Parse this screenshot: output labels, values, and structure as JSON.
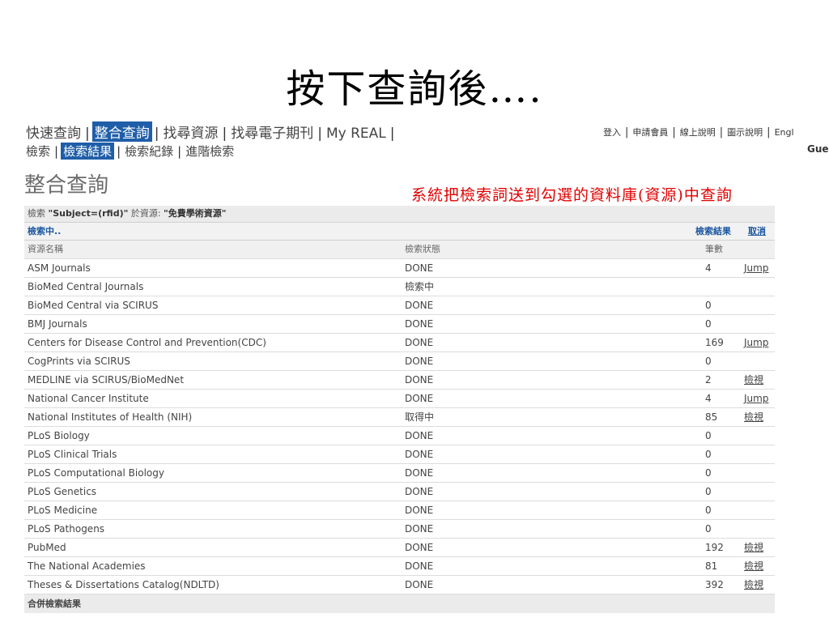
{
  "slide_title": "按下查詢後….",
  "nav_primary": [
    {
      "label": "快速查詢",
      "active": false
    },
    {
      "label": "整合查詢",
      "active": true
    },
    {
      "label": "找尋資源",
      "active": false
    },
    {
      "label": "找尋電子期刊",
      "active": false
    },
    {
      "label": "My REAL",
      "active": false
    }
  ],
  "nav_secondary": [
    {
      "label": "檢索",
      "active": false
    },
    {
      "label": "檢索結果",
      "active": true
    },
    {
      "label": "檢索紀錄",
      "active": false
    },
    {
      "label": "進階檢索",
      "active": false
    }
  ],
  "top_links": [
    "登入",
    "申請會員",
    "線上說明",
    "圖示說明",
    "Engl"
  ],
  "guest_label": "Gue",
  "page_title": "整合查詢",
  "annotation": "系統把檢索詞送到勾選的資料庫(資源)中查詢",
  "query_bar": {
    "prefix": "檢索 ",
    "query": "\"Subject=(rfid)\"",
    "middle": " 於資源: ",
    "resource": "\"免費學術資源\""
  },
  "status_bar": {
    "status": "檢索中..",
    "results_link": "檢索結果",
    "cancel_link": "取消"
  },
  "table": {
    "headers": {
      "name": "資源名稱",
      "status": "檢索狀態",
      "count": "筆數"
    },
    "rows": [
      {
        "name": "ASM Journals",
        "status": "DONE",
        "count": "4",
        "link": "Jump"
      },
      {
        "name": "BioMed Central Journals",
        "status": "檢索中",
        "count": "",
        "link": ""
      },
      {
        "name": "BioMed Central via SCIRUS",
        "status": "DONE",
        "count": "0",
        "link": ""
      },
      {
        "name": "BMJ Journals",
        "status": "DONE",
        "count": "0",
        "link": ""
      },
      {
        "name": "Centers for Disease Control and Prevention(CDC)",
        "status": "DONE",
        "count": "169",
        "link": "Jump"
      },
      {
        "name": "CogPrints via SCIRUS",
        "status": "DONE",
        "count": "0",
        "link": ""
      },
      {
        "name": "MEDLINE via SCIRUS/BioMedNet",
        "status": "DONE",
        "count": "2",
        "link": "檢視"
      },
      {
        "name": "National Cancer Institute",
        "status": "DONE",
        "count": "4",
        "link": "Jump"
      },
      {
        "name": "National Institutes of Health (NIH)",
        "status": "取得中",
        "count": "85",
        "link": "檢視"
      },
      {
        "name": "PLoS Biology",
        "status": "DONE",
        "count": "0",
        "link": ""
      },
      {
        "name": "PLoS Clinical Trials",
        "status": "DONE",
        "count": "0",
        "link": ""
      },
      {
        "name": "PLoS Computational Biology",
        "status": "DONE",
        "count": "0",
        "link": ""
      },
      {
        "name": "PLoS Genetics",
        "status": "DONE",
        "count": "0",
        "link": ""
      },
      {
        "name": "PLoS Medicine",
        "status": "DONE",
        "count": "0",
        "link": ""
      },
      {
        "name": "PLoS Pathogens",
        "status": "DONE",
        "count": "0",
        "link": ""
      },
      {
        "name": "PubMed",
        "status": "DONE",
        "count": "192",
        "link": "檢視"
      },
      {
        "name": "The National Academies",
        "status": "DONE",
        "count": "81",
        "link": "檢視"
      },
      {
        "name": "Theses & Dissertations Catalog(NDLTD)",
        "status": "DONE",
        "count": "392",
        "link": "檢視"
      }
    ]
  },
  "footer": "合併檢索結果",
  "colors": {
    "active_tab_bg": "#1f5ea8",
    "annotation": "#e00000",
    "link_blue": "#1a56a0"
  }
}
